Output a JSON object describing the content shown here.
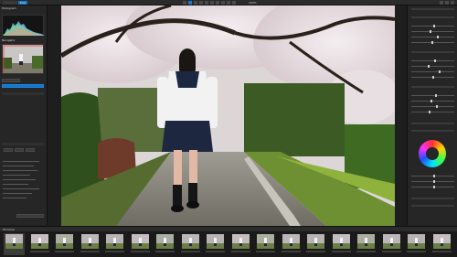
{
  "app": {
    "logo_label": "",
    "mode_tab": "Edit",
    "zoom": "100%"
  },
  "left_panel": {
    "histogram_title": "Histogram",
    "navigator_title": "Navigator"
  },
  "film_bar": {
    "label": "Filmstrip"
  },
  "film_thumbs": 18,
  "colors": {
    "accent": "#1676c9",
    "panel": "#262626",
    "bg": "#1e1e1e"
  }
}
